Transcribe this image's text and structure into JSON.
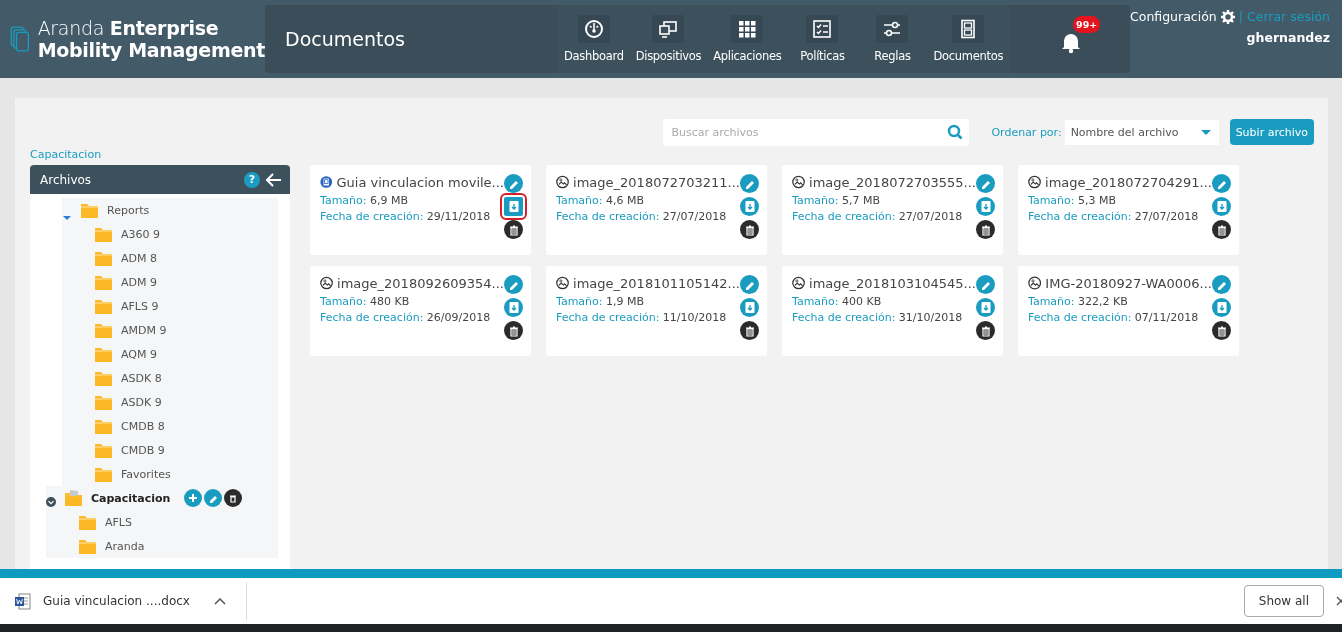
{
  "header": {
    "logo_lines": [
      "Aranda **Enterprise**",
      "Mobility Management"
    ],
    "page_title": "Documentos",
    "nav": [
      {
        "kind": "dashboard",
        "label": "Dashboard"
      },
      {
        "kind": "devices",
        "label": "Dispositivos"
      },
      {
        "kind": "apps",
        "label": "Aplicaciones"
      },
      {
        "kind": "policies",
        "label": "Políticas"
      },
      {
        "kind": "rules",
        "label": "Reglas"
      },
      {
        "kind": "documents",
        "label": "Documentos"
      }
    ],
    "notifications_badge": "99+",
    "settings_link": "Configuración",
    "separator": "|",
    "logout_link": "Cerrar sesión",
    "username": "ghernandez"
  },
  "breadcrumb": "Capacitacion",
  "search": {
    "placeholder": "Buscar archivos"
  },
  "sort": {
    "label": "Ordenar por:",
    "value": "Nombre del archivo"
  },
  "upload_button": "Subir archivo",
  "tree": {
    "title": "Archivos",
    "help": "?",
    "items": [
      {
        "label": "Reports",
        "expanded": true,
        "selected": false,
        "children": [
          {
            "label": "A360 9"
          },
          {
            "label": "ADM 8"
          },
          {
            "label": "ADM 9"
          },
          {
            "label": "AFLS 9"
          },
          {
            "label": "AMDM 9"
          },
          {
            "label": "AQM 9"
          },
          {
            "label": "ASDK 8"
          },
          {
            "label": "ASDK 9"
          },
          {
            "label": "CMDB 8"
          },
          {
            "label": "CMDB 9"
          },
          {
            "label": "Favorites"
          }
        ]
      },
      {
        "label": "Capacitacion",
        "expanded": true,
        "selected": true,
        "children": [
          {
            "label": "AFLS"
          },
          {
            "label": "Aranda"
          }
        ]
      }
    ]
  },
  "files": [
    {
      "kind": "document",
      "name": "Guia vinculacion movile...",
      "size_label": "Tamaño:",
      "size": "6,9 MB",
      "date_label": "Fecha de creación:",
      "date": "29/11/2018",
      "highlighted": true
    },
    {
      "kind": "image",
      "name": "image_2018072703211...",
      "size_label": "Tamaño:",
      "size": "4,6 MB",
      "date_label": "Fecha de creación:",
      "date": "27/07/2018",
      "highlighted": false
    },
    {
      "kind": "image",
      "name": "image_2018072703555...",
      "size_label": "Tamaño:",
      "size": "5,7 MB",
      "date_label": "Fecha de creación:",
      "date": "27/07/2018",
      "highlighted": false
    },
    {
      "kind": "image",
      "name": "image_2018072704291...",
      "size_label": "Tamaño:",
      "size": "5,3 MB",
      "date_label": "Fecha de creación:",
      "date": "27/07/2018",
      "highlighted": false
    },
    {
      "kind": "image",
      "name": "image_2018092609354...",
      "size_label": "Tamaño:",
      "size": "480 KB",
      "date_label": "Fecha de creación:",
      "date": "26/09/2018",
      "highlighted": false
    },
    {
      "kind": "image",
      "name": "image_2018101105142...",
      "size_label": "Tamaño:",
      "size": "1,9 MB",
      "date_label": "Fecha de creación:",
      "date": "11/10/2018",
      "highlighted": false
    },
    {
      "kind": "image",
      "name": "image_2018103104545...",
      "size_label": "Tamaño:",
      "size": "400 KB",
      "date_label": "Fecha de creación:",
      "date": "31/10/2018",
      "highlighted": false
    },
    {
      "kind": "image",
      "name": "IMG-20180927-WA0006...",
      "size_label": "Tamaño:",
      "size": "322,2 KB",
      "date_label": "Fecha de creación:",
      "date": "07/11/2018",
      "highlighted": false
    }
  ],
  "download_bar": {
    "file": "Guia vinculacion ....docx",
    "show_all": "Show all"
  }
}
